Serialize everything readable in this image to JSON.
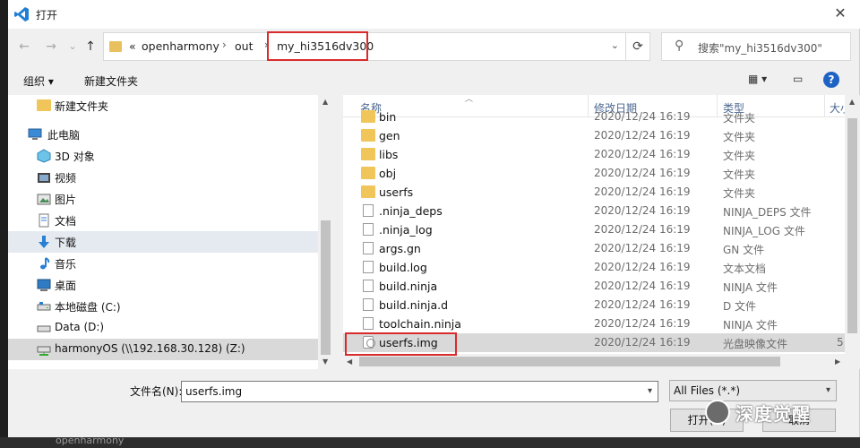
{
  "window": {
    "title": "打开",
    "close_glyph": "✕"
  },
  "nav": {
    "back_glyph": "←",
    "forward_glyph": "→",
    "history_glyph": "⌄",
    "up_glyph": "↑",
    "breadcrumb": [
      "«",
      "openharmony",
      "›",
      "out",
      "›",
      "my_hi3516dv300"
    ],
    "refresh_glyph": "⟳",
    "search_placeholder": "搜索\"my_hi3516dv300\""
  },
  "toolbar": {
    "organize": "组织 ▾",
    "new_folder": "新建文件夹",
    "view_glyph": "▦ ▾",
    "pane_glyph": "▭",
    "help_glyph": "?"
  },
  "sidebar": {
    "items": [
      {
        "label": "新建文件夹",
        "icon": "folder-icon"
      },
      {
        "label": "此电脑",
        "icon": "computer-icon"
      },
      {
        "label": "3D 对象",
        "icon": "3d-objects-icon"
      },
      {
        "label": "视频",
        "icon": "video-icon"
      },
      {
        "label": "图片",
        "icon": "pictures-icon"
      },
      {
        "label": "文档",
        "icon": "documents-icon"
      },
      {
        "label": "下载",
        "icon": "download-icon"
      },
      {
        "label": "音乐",
        "icon": "music-icon"
      },
      {
        "label": "桌面",
        "icon": "desktop-icon"
      },
      {
        "label": "本地磁盘 (C:)",
        "icon": "drive-icon"
      },
      {
        "label": "Data (D:)",
        "icon": "drive-icon"
      },
      {
        "label": "harmonyOS (\\\\192.168.30.128) (Z:)",
        "icon": "network-drive-icon"
      }
    ]
  },
  "columns": {
    "name": "名称",
    "date": "修改日期",
    "type": "类型",
    "size": "大小"
  },
  "files": [
    {
      "name": "bin",
      "date": "2020/12/24 16:19",
      "type": "文件夹",
      "kind": "folder"
    },
    {
      "name": "gen",
      "date": "2020/12/24 16:19",
      "type": "文件夹",
      "kind": "folder"
    },
    {
      "name": "libs",
      "date": "2020/12/24 16:19",
      "type": "文件夹",
      "kind": "folder"
    },
    {
      "name": "obj",
      "date": "2020/12/24 16:19",
      "type": "文件夹",
      "kind": "folder"
    },
    {
      "name": "userfs",
      "date": "2020/12/24 16:19",
      "type": "文件夹",
      "kind": "folder"
    },
    {
      "name": ".ninja_deps",
      "date": "2020/12/24 16:19",
      "type": "NINJA_DEPS 文件",
      "kind": "doc"
    },
    {
      "name": ".ninja_log",
      "date": "2020/12/24 16:19",
      "type": "NINJA_LOG 文件",
      "kind": "doc"
    },
    {
      "name": "args.gn",
      "date": "2020/12/24 16:19",
      "type": "GN 文件",
      "kind": "doc"
    },
    {
      "name": "build.log",
      "date": "2020/12/24 16:19",
      "type": "文本文档",
      "kind": "doc"
    },
    {
      "name": "build.ninja",
      "date": "2020/12/24 16:19",
      "type": "NINJA 文件",
      "kind": "doc"
    },
    {
      "name": "build.ninja.d",
      "date": "2020/12/24 16:19",
      "type": "D 文件",
      "kind": "doc"
    },
    {
      "name": "toolchain.ninja",
      "date": "2020/12/24 16:19",
      "type": "NINJA 文件",
      "kind": "doc"
    },
    {
      "name": "userfs.img",
      "date": "2020/12/24 16:19",
      "type": "光盘映像文件",
      "size": "5",
      "kind": "disc"
    }
  ],
  "bottom": {
    "filename_label": "文件名(N):",
    "filename_value": "userfs.img",
    "filetype_value": "All Files (*.*)",
    "open_button": "打开(O)",
    "cancel_button": "取消"
  },
  "watermark": "深度觉醒",
  "background_caption": "openharmony",
  "colors": {
    "highlight": "#d92b2b",
    "selected_row": "#d9d9d9",
    "folder": "#f0c65a",
    "accent": "#1e63c4"
  }
}
